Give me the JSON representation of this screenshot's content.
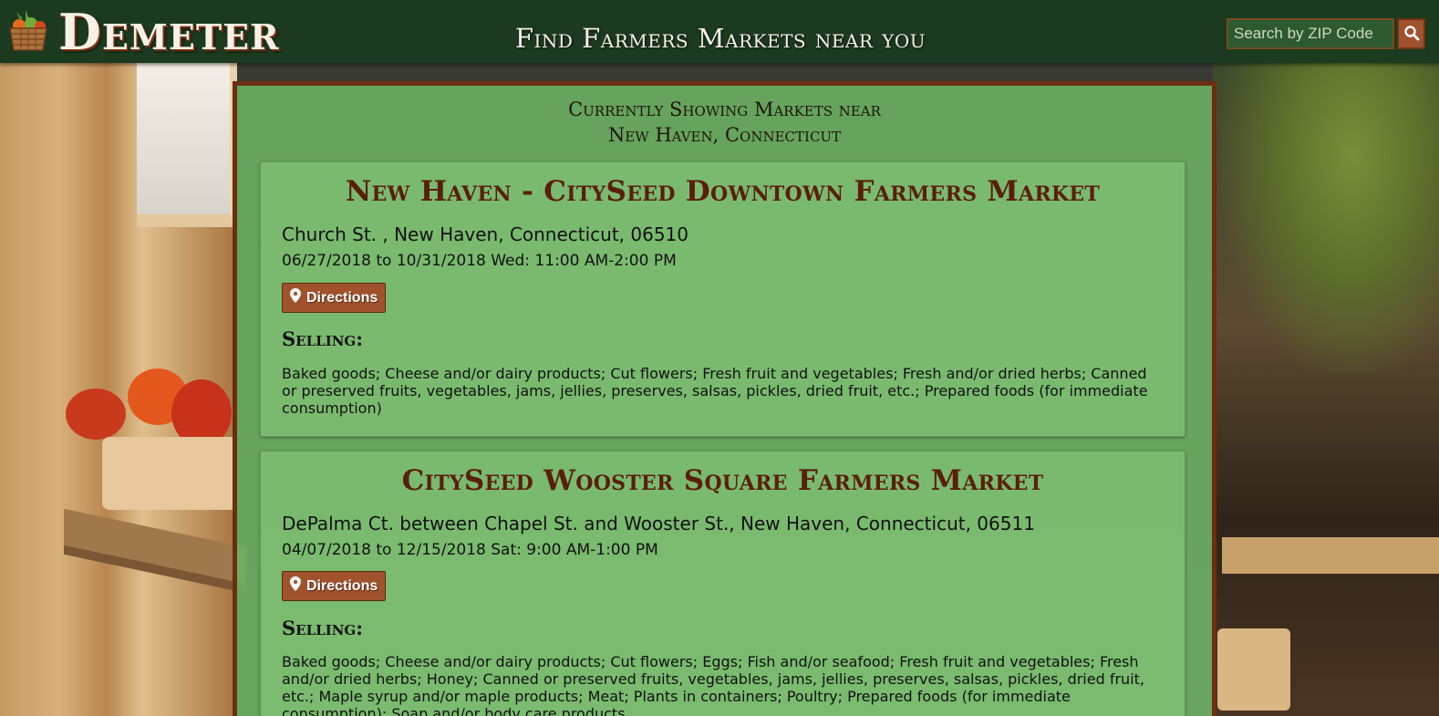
{
  "header": {
    "brand": "Demeter",
    "tagline": "Find Farmers Markets near you",
    "search_placeholder": "Search by ZIP Code"
  },
  "location": {
    "line1": "Currently Showing Markets near",
    "line2": "New Haven, Connecticut"
  },
  "markets": [
    {
      "name": "New Haven - CitySeed Downtown Farmers Market",
      "address": "Church St. , New Haven, Connecticut, 06510",
      "schedule": "06/27/2018 to 10/31/2018 Wed: 11:00 AM-2:00 PM",
      "directions_label": "Directions",
      "selling_heading": "Selling:",
      "products": "Baked goods; Cheese and/or dairy products; Cut flowers; Fresh fruit and vegetables; Fresh and/or dried herbs; Canned or preserved fruits, vegetables, jams, jellies, preserves, salsas, pickles, dried fruit, etc.; Prepared foods (for immediate consumption)"
    },
    {
      "name": "CitySeed Wooster Square Farmers Market",
      "address": "DePalma Ct. between Chapel St. and Wooster St., New Haven, Connecticut, 06511",
      "schedule": "04/07/2018 to 12/15/2018 Sat: 9:00 AM-1:00 PM",
      "directions_label": "Directions",
      "selling_heading": "Selling:",
      "products": "Baked goods; Cheese and/or dairy products; Cut flowers; Eggs; Fish and/or seafood; Fresh fruit and vegetables; Fresh and/or dried herbs; Honey; Canned or preserved fruits, vegetables, jams, jellies, preserves, salsas, pickles, dried fruit, etc.; Maple syrup and/or maple products; Meat; Plants in containers; Poultry; Prepared foods (for immediate consumption); Soap and/or body care products"
    }
  ],
  "colors": {
    "header_bg": "#1b3a1f",
    "panel_bg": "#6cb262",
    "accent_brown": "#a0522d",
    "title_brown": "#5a1e0c"
  },
  "icons": {
    "logo": "vegetable-basket-icon",
    "search": "magnifier-icon",
    "directions": "map-pin-icon"
  }
}
